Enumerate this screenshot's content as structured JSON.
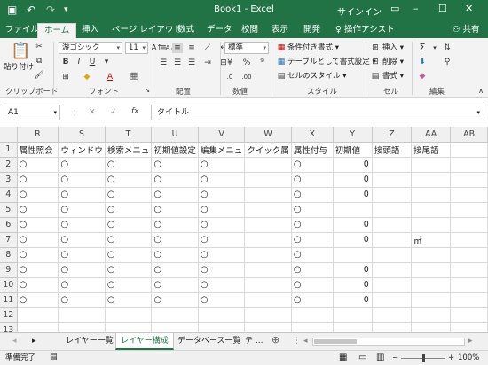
{
  "titlebar": {
    "save_icon": "save-icon",
    "undo_icon": "undo-icon",
    "redo_icon": "redo-icon",
    "title": "Book1 - Excel",
    "signin": "サインイン",
    "minimize": "–",
    "maximize": "☐",
    "close": "✕"
  },
  "tabs": [
    "ファイル",
    "ホーム",
    "挿入",
    "ページ レイアウト",
    "数式",
    "データ",
    "校閲",
    "表示",
    "開発",
    "♀ 操作アシスト"
  ],
  "share": "共有",
  "ribbon": {
    "clipboard": {
      "paste": "貼り付け",
      "label": "クリップボード"
    },
    "font": {
      "name": "游ゴシック",
      "size": "11",
      "bold": "B",
      "italic": "I",
      "underline": "U",
      "grow": "A↑",
      "shrink": "A↓",
      "font_color": "A",
      "label": "フォント"
    },
    "alignment": {
      "label": "配置"
    },
    "number": {
      "format": "標準",
      "percent": "%",
      "comma": "⁹",
      "label": "数値"
    },
    "styles": {
      "conditional": "条件付き書式 ▾",
      "table": "テーブルとして書式設定 ▾",
      "cell_styles": "セルのスタイル ▾",
      "label": "スタイル"
    },
    "cells": {
      "insert": "挿入 ▾",
      "delete": "削除 ▾",
      "format": "書式 ▾",
      "label": "セル"
    },
    "editing": {
      "label": "編集"
    }
  },
  "formula_bar": {
    "namebox": "A1",
    "cancel": "✕",
    "enter": "✓",
    "fx": "fx",
    "content": "タイトル"
  },
  "columns": [
    "R",
    "S",
    "T",
    "U",
    "V",
    "W",
    "X",
    "Y",
    "Z",
    "AA",
    "AB"
  ],
  "rows": [
    {
      "n": "1",
      "cells": [
        "属性照会",
        "ウィンドウ",
        "検索メニュ",
        "初期値設定",
        "編集メニュ",
        "クイック属",
        "属性付与",
        "初期値",
        "接頭語",
        "接尾語",
        ""
      ]
    },
    {
      "n": "2",
      "cells": [
        "○",
        "○",
        "○",
        "○",
        "○",
        "",
        "○",
        "0",
        "",
        "",
        ""
      ]
    },
    {
      "n": "3",
      "cells": [
        "○",
        "○",
        "○",
        "○",
        "○",
        "",
        "○",
        "0",
        "",
        "",
        ""
      ]
    },
    {
      "n": "4",
      "cells": [
        "○",
        "○",
        "○",
        "○",
        "○",
        "",
        "○",
        "0",
        "",
        "",
        ""
      ]
    },
    {
      "n": "5",
      "cells": [
        "○",
        "○",
        "○",
        "○",
        "○",
        "",
        "○",
        "",
        "",
        "",
        ""
      ]
    },
    {
      "n": "6",
      "cells": [
        "○",
        "○",
        "○",
        "○",
        "○",
        "",
        "○",
        "0",
        "",
        "",
        ""
      ]
    },
    {
      "n": "7",
      "cells": [
        "○",
        "○",
        "○",
        "○",
        "○",
        "",
        "○",
        "0",
        "",
        "㎡",
        ""
      ]
    },
    {
      "n": "8",
      "cells": [
        "○",
        "○",
        "○",
        "○",
        "○",
        "",
        "○",
        "",
        "",
        "",
        ""
      ]
    },
    {
      "n": "9",
      "cells": [
        "○",
        "○",
        "○",
        "○",
        "○",
        "",
        "○",
        "0",
        "",
        "",
        ""
      ]
    },
    {
      "n": "10",
      "cells": [
        "○",
        "○",
        "○",
        "○",
        "○",
        "",
        "○",
        "0",
        "",
        "",
        ""
      ]
    },
    {
      "n": "11",
      "cells": [
        "○",
        "○",
        "○",
        "○",
        "○",
        "",
        "○",
        "0",
        "",
        "",
        ""
      ]
    },
    {
      "n": "12",
      "cells": [
        "",
        "",
        "",
        "",
        "",
        "",
        "",
        "",
        "",
        "",
        ""
      ]
    },
    {
      "n": "13",
      "cells": [
        "",
        "",
        "",
        "",
        "",
        "",
        "",
        "",
        "",
        "",
        ""
      ]
    }
  ],
  "sheets": {
    "prev": "◂",
    "next": "▸",
    "tabs": [
      "レイヤー一覧",
      "レイヤー構成",
      "データベース一覧",
      "テ ..."
    ],
    "active": 1,
    "add": "⊕"
  },
  "status": {
    "ready": "準備完了",
    "zoom_minus": "−",
    "zoom_plus": "+",
    "zoom": "100%"
  },
  "colors": {
    "accent": "#217346"
  }
}
